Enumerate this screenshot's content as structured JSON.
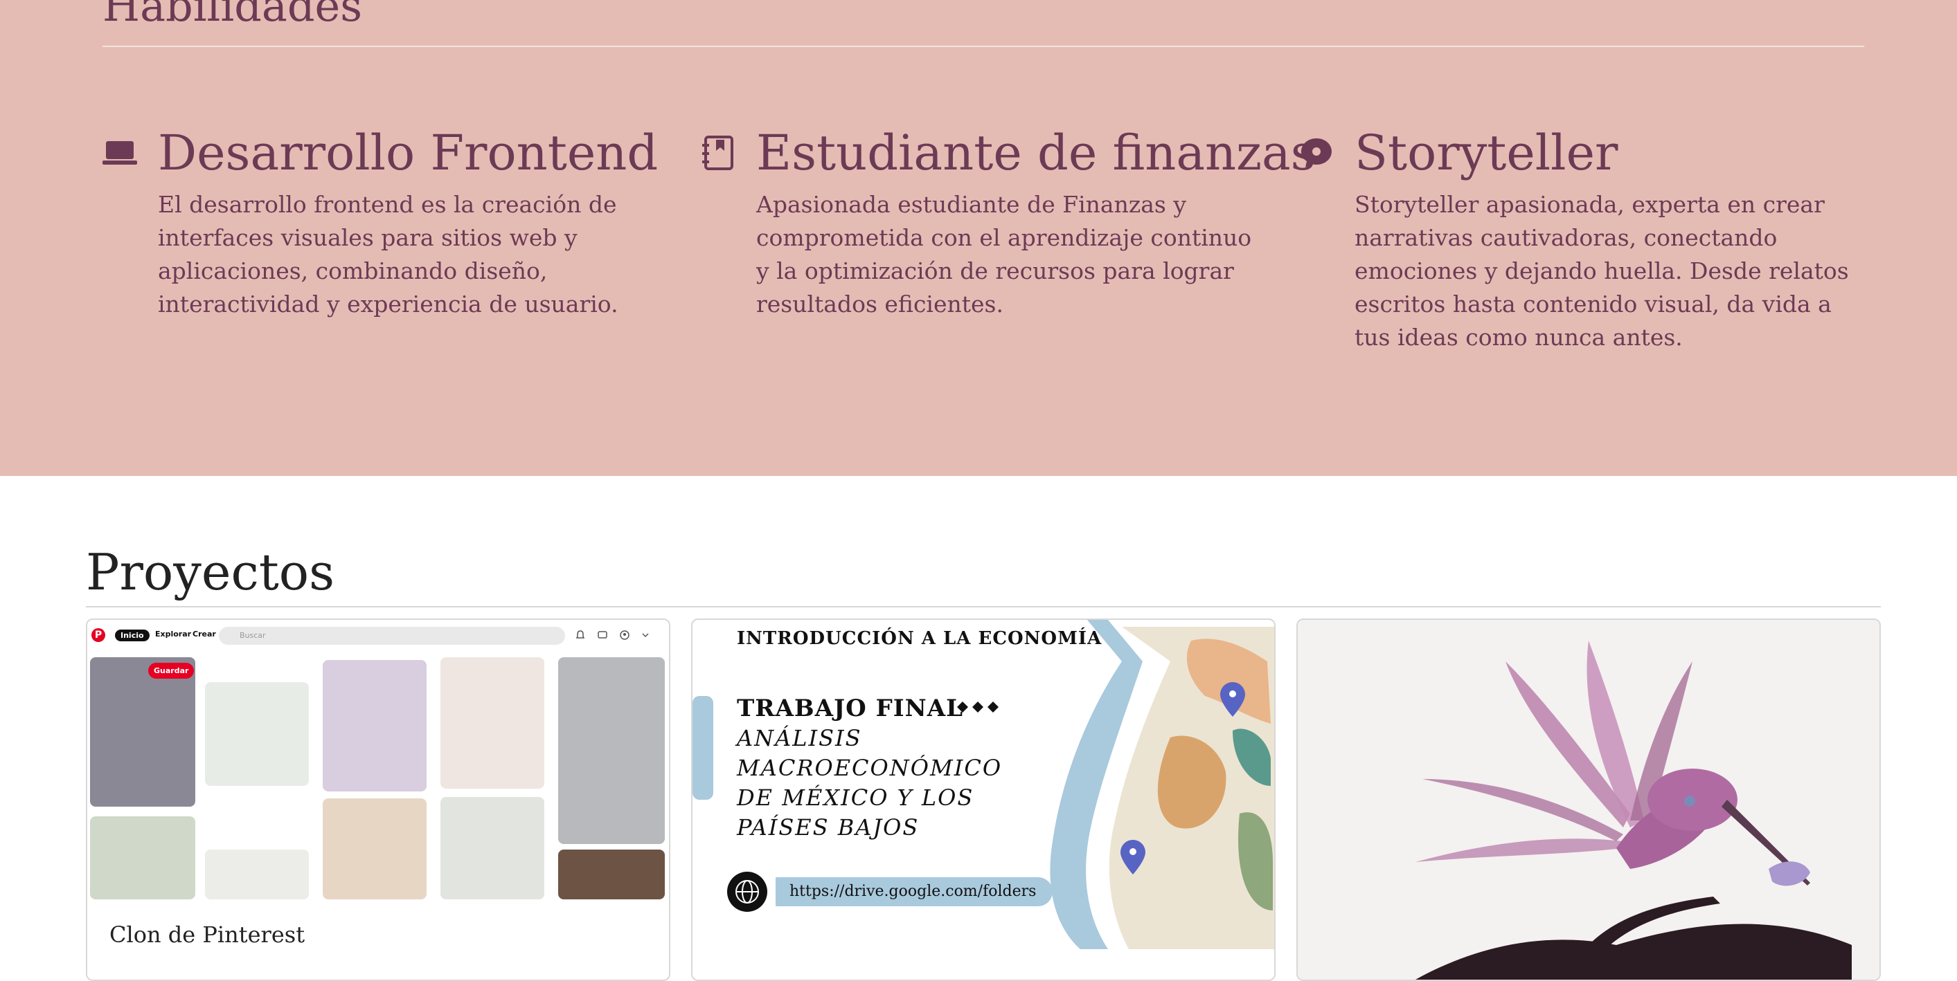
{
  "skills": {
    "title": "Habilidades",
    "items": [
      {
        "icon": "laptop-icon",
        "title": "Desarrollo Frontend",
        "description": "El desarrollo frontend es la creación de interfaces visuales para sitios web y aplicaciones, combinando diseño, interactividad y experiencia de usuario."
      },
      {
        "icon": "address-book-icon",
        "title": "Estudiante de finanzas",
        "description": "Apasionada estudiante de Finanzas y comprometida con el aprendizaje continuo y la optimización de recursos para lograr resultados eficientes."
      },
      {
        "icon": "chat-bubble-icon",
        "title": "Storyteller",
        "description": "Storyteller apasionada, experta en crear narrativas cautivadoras, conectando emociones y dejando huella. Desde relatos escritos hasta contenido visual, da vida a tus ideas como nunca antes."
      }
    ]
  },
  "projects": {
    "title": "Proyectos",
    "cards": [
      {
        "title": "Clon de Pinterest",
        "preview": {
          "nav": [
            "Inicio",
            "Explorar",
            "Crear"
          ],
          "search_placeholder": "Buscar",
          "save_label": "Guardar"
        }
      },
      {
        "title": "",
        "preview": {
          "heading": "INTRODUCCIÓN A LA ECONOMÍA",
          "subheading": "TRABAJO FINAL",
          "subtitle": "ANÁLISIS MACROECONÓMICO DE MÉXICO Y LOS PAÍSES BAJOS",
          "link": "https://drive.google.com/folders"
        }
      },
      {
        "title": ""
      }
    ]
  },
  "colors": {
    "skills_bg": "#e5bcb4",
    "accent": "#6d3a55",
    "pinterest_red": "#e60023",
    "map_blue": "#a9c9dd"
  }
}
